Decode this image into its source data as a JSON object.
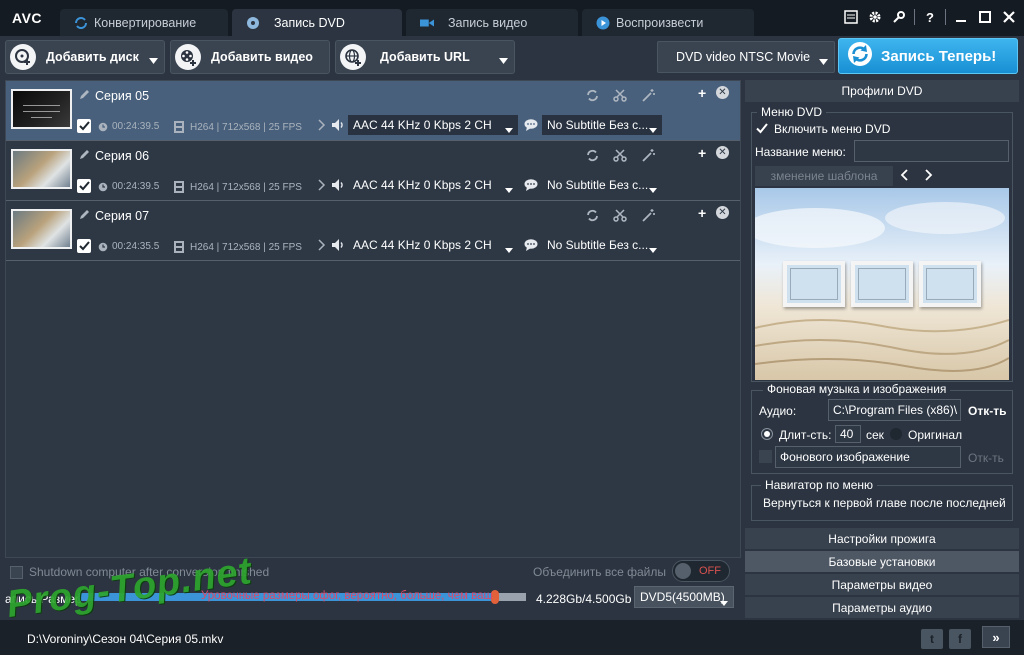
{
  "app": {
    "logo": "AVC"
  },
  "tabs": [
    {
      "label": "Конвертирование"
    },
    {
      "label": "Запись DVD"
    },
    {
      "label": "Запись видео"
    },
    {
      "label": "Воспроизвести"
    }
  ],
  "window_controls": {
    "help": "?"
  },
  "toolbar": {
    "add_disc": "Добавить диск",
    "add_video": "Добавить видео",
    "add_url": "Добавить URL",
    "profile": "DVD video NTSC Movie",
    "burn_now": "Запись Теперь!"
  },
  "files": [
    {
      "name": "Серия 05",
      "duration": "00:24:39.5",
      "video_info": "H264 | 712x568 | 25 FPS",
      "audio": "AAC 44 KHz 0 Kbps 2 CH",
      "subtitle": "No Subtitle Без с..."
    },
    {
      "name": "Серия 06",
      "duration": "00:24:39.5",
      "video_info": "H264 | 712x568 | 25 FPS",
      "audio": "AAC 44 KHz 0 Kbps 2 CH",
      "subtitle": "No Subtitle Без с..."
    },
    {
      "name": "Серия 07",
      "duration": "00:24:35.5",
      "video_info": "H264 | 712x568 | 25 FPS",
      "audio": "AAC 44 KHz 0 Kbps 2 CH",
      "subtitle": "No Subtitle Без с..."
    }
  ],
  "bottom": {
    "shutdown": "Shutdown computer after conversion finished",
    "merge": "Объединить все файлы",
    "merge_toggle": "OFF",
    "size_label": "апись Размер",
    "size_warning": "Уровочные размеры офог, вероятно, больше, чем ваш",
    "size_fraction": 0.94,
    "size_value": "4.228Gb/4.500Gb",
    "disc_type": "DVD5(4500MB)"
  },
  "status": {
    "path": "D:\\Voroniny\\Сезон 04\\Серия 05.mkv",
    "twitter": "t",
    "facebook": "f",
    "next": "»"
  },
  "watermark": "Prog-Top.net",
  "right_panel": {
    "header": "Профили DVD",
    "menu_group": "Меню DVD",
    "enable_menu": "Включить меню DVD",
    "menu_name_label": "Название меню:",
    "menu_name_value": "",
    "change_template": "зменение шаблона",
    "music_group": "Фоновая музыка и изображения",
    "audio_label": "Аудио:",
    "audio_path": "C:\\Program Files (x86)\\",
    "open": "Отк-ть",
    "duration_label": "Длит-сть:",
    "duration_value": "40",
    "duration_unit": "сек",
    "original": "Оригинал",
    "background_image": "Фонового изображение",
    "open_disabled": "Отк-ть",
    "navigator_group": "Навигатор по меню",
    "navigator_text": "Вернуться к первой главе после последней",
    "accordion": [
      {
        "label": "Настройки прожига"
      },
      {
        "label": "Базовые установки"
      },
      {
        "label": "Параметры видео"
      },
      {
        "label": "Параметры аудио"
      }
    ]
  }
}
